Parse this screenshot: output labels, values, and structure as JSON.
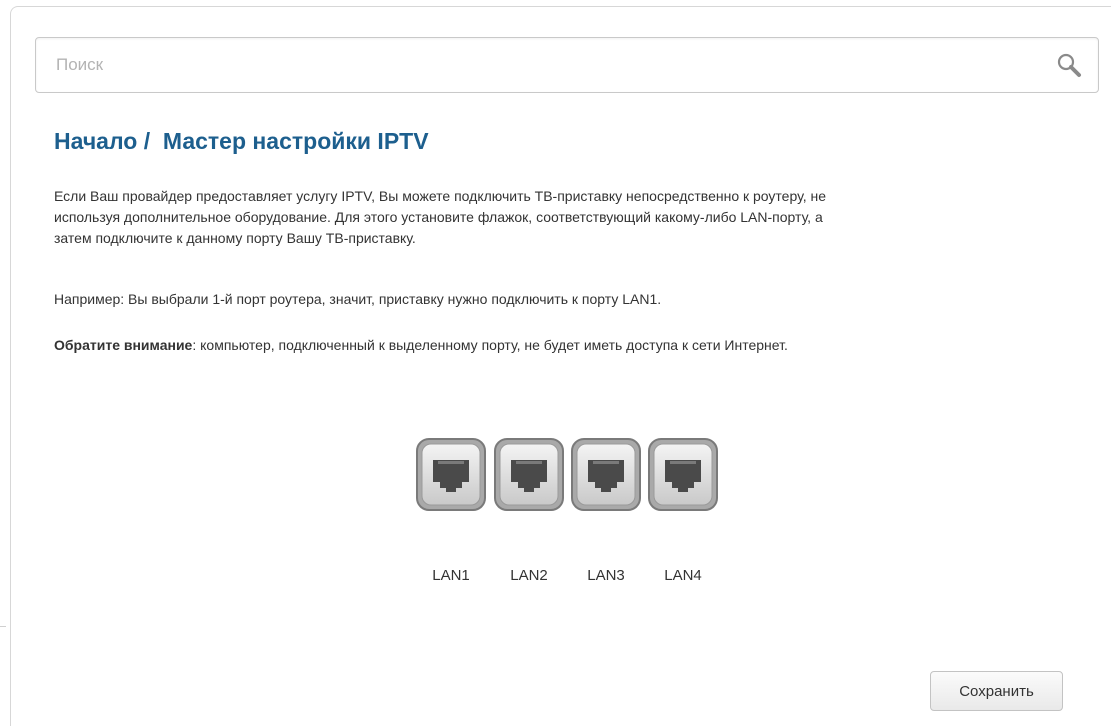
{
  "search": {
    "placeholder": "Поиск",
    "value": "",
    "icon": "search-icon"
  },
  "header": {
    "title": "Начало /  Мастер настройки IPTV"
  },
  "content": {
    "paragraph1": "Если Ваш провайдер предоставляет услугу IPTV, Вы можете подключить ТВ-приставку непосредственно к роутеру, не используя дополнительное оборудование. Для этого установите флажок, соответствующий какому-либо LAN-порту, а затем подключите к данному порту Вашу ТВ-приставку.",
    "paragraph2": "Например: Вы выбрали 1-й порт роутера, значит, приставку нужно подключить к порту LAN1.",
    "note_label": "Обратите внимание",
    "note_text": ": компьютер, подключенный к выделенному порту, не будет иметь доступа к сети Интернет."
  },
  "ports": [
    {
      "label": "LAN1",
      "icon": "ethernet-port-icon",
      "selected": false
    },
    {
      "label": "LAN2",
      "icon": "ethernet-port-icon",
      "selected": false
    },
    {
      "label": "LAN3",
      "icon": "ethernet-port-icon",
      "selected": false
    },
    {
      "label": "LAN4",
      "icon": "ethernet-port-icon",
      "selected": false
    }
  ],
  "actions": {
    "save_label": "Сохранить"
  },
  "colors": {
    "title": "#1d5f8e",
    "text": "#333333",
    "border": "#c9c9c9"
  }
}
